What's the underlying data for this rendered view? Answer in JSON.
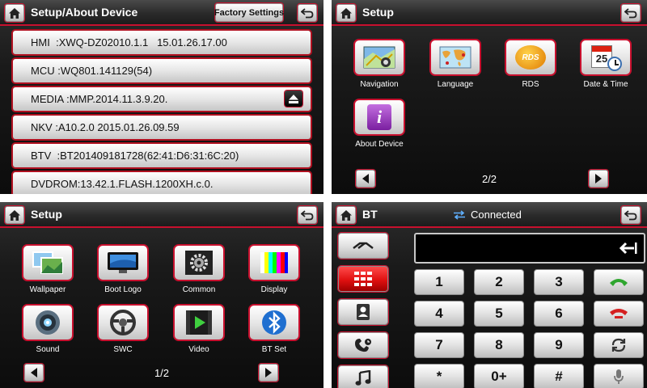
{
  "about": {
    "title": "Setup/About Device",
    "factory_label": "Factory Settings",
    "rows": [
      {
        "label": "HMI",
        "sep": "  :",
        "value": "XWQ-DZ02010.1.1   15.01.26.17.00"
      },
      {
        "label": "MCU",
        "sep": " :",
        "value": "WQ801.141129(54)"
      },
      {
        "label": "MEDIA",
        "sep": " :",
        "value": "MMP.2014.11.3.9.20."
      },
      {
        "label": "NKV",
        "sep": " :",
        "value": "A10.2.0 2015.01.26.09.59"
      },
      {
        "label": "BTV",
        "sep": "  :",
        "value": "BT201409181728(62:41:D6:31:6C:20)"
      },
      {
        "label": "DVDROM",
        "sep": ":",
        "value": "13.42.1.FLASH.1200XH.c.0."
      }
    ]
  },
  "setup_page2": {
    "title": "Setup",
    "apps": [
      {
        "label": "Navigation",
        "icon": "map-icon"
      },
      {
        "label": "Language",
        "icon": "world-map-icon"
      },
      {
        "label": "RDS",
        "icon": "rds-icon"
      },
      {
        "label": "Date & Time",
        "icon": "calendar-clock-icon"
      },
      {
        "label": "About Device",
        "icon": "info-icon"
      }
    ],
    "rds_badge": "RDS",
    "calendar_num": "25",
    "page": "2/2"
  },
  "setup_page1": {
    "title": "Setup",
    "apps": [
      {
        "label": "Wallpaper",
        "icon": "wallpaper-icon"
      },
      {
        "label": "Boot Logo",
        "icon": "monitor-icon"
      },
      {
        "label": "Common",
        "icon": "gear-icon"
      },
      {
        "label": "Display",
        "icon": "color-bars-icon"
      },
      {
        "label": "Sound",
        "icon": "speaker-icon"
      },
      {
        "label": "SWC",
        "icon": "steering-wheel-icon"
      },
      {
        "label": "Video",
        "icon": "video-icon"
      },
      {
        "label": "BT Set",
        "icon": "bluetooth-icon"
      }
    ],
    "page": "1/2"
  },
  "bt": {
    "title": "BT",
    "status": "Connected",
    "keys": [
      "1",
      "2",
      "3",
      "4",
      "5",
      "6",
      "7",
      "8",
      "9",
      "*",
      "0+",
      "#"
    ]
  },
  "colors": {
    "accent": "#c8102e",
    "call_green": "#2fa62f",
    "hangup_red": "#d42020"
  }
}
